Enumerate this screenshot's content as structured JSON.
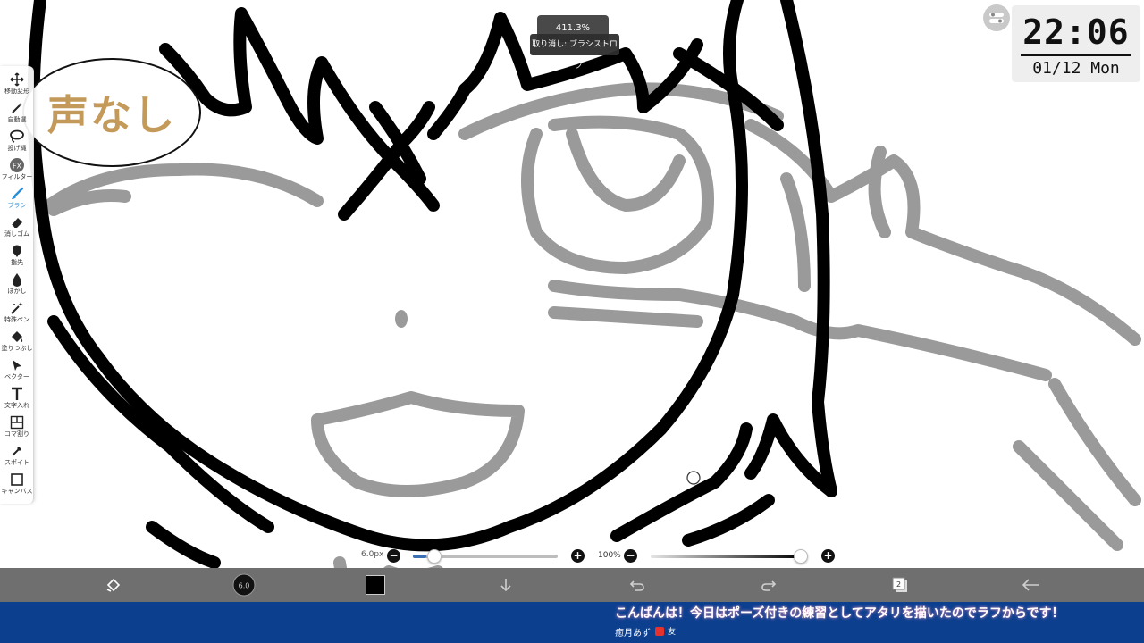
{
  "canvas": {
    "zoom_label": "411.3%",
    "undo_toast": "取り消し: ブラシストローク"
  },
  "overlay": {
    "no_voice_label": "声なし"
  },
  "clock": {
    "time": "22:06",
    "date": "01/12 Mon"
  },
  "toolbar": {
    "items": [
      {
        "label": "移動変形",
        "icon": "move-icon"
      },
      {
        "label": "自動選",
        "icon": "magic-wand-icon"
      },
      {
        "label": "投げ縄",
        "icon": "lasso-icon"
      },
      {
        "label": "フィルター",
        "icon": "fx-icon"
      },
      {
        "label": "ブラシ",
        "icon": "brush-icon"
      },
      {
        "label": "消しゴム",
        "icon": "eraser-icon"
      },
      {
        "label": "指先",
        "icon": "finger-icon"
      },
      {
        "label": "ぼかし",
        "icon": "blur-icon"
      },
      {
        "label": "特殊ペン",
        "icon": "special-pen-icon"
      },
      {
        "label": "塗りつぶし",
        "icon": "fill-icon"
      },
      {
        "label": "ベクター",
        "icon": "vector-icon"
      },
      {
        "label": "文字入れ",
        "icon": "text-icon"
      },
      {
        "label": "コマ割り",
        "icon": "panel-icon"
      },
      {
        "label": "スポイト",
        "icon": "eyedropper-icon"
      },
      {
        "label": "キャンバス",
        "icon": "canvas-icon"
      }
    ],
    "active_label": "ブラシ",
    "active_color": "#2a8fd6"
  },
  "sliders": {
    "brush_size_label": "6.0px",
    "brush_size_fraction": 0.09,
    "opacity_label": "100%",
    "opacity_fraction": 1.0
  },
  "bottom_bar": {
    "items": [
      {
        "name": "transform-icon"
      },
      {
        "name": "brush-size-icon",
        "label": "6.0"
      },
      {
        "name": "color-swatch",
        "color": "#000000"
      },
      {
        "name": "download-icon"
      },
      {
        "name": "undo-icon"
      },
      {
        "name": "redo-icon"
      },
      {
        "name": "layers-icon",
        "label": "2"
      },
      {
        "name": "back-icon"
      }
    ]
  },
  "ticker": {
    "message": "こんばんは！今日はポーズ付きの練習としてアタリを描いたのでラフからです！",
    "author": "癒月あず",
    "badge_text": "友"
  },
  "colors": {
    "sketch_black": "#000000",
    "sketch_gray": "#9a9a9a",
    "bottom_bar": "#6f6f6f",
    "ticker_bg": "#0d3f8f",
    "bubble_text": "#c49a5a"
  }
}
